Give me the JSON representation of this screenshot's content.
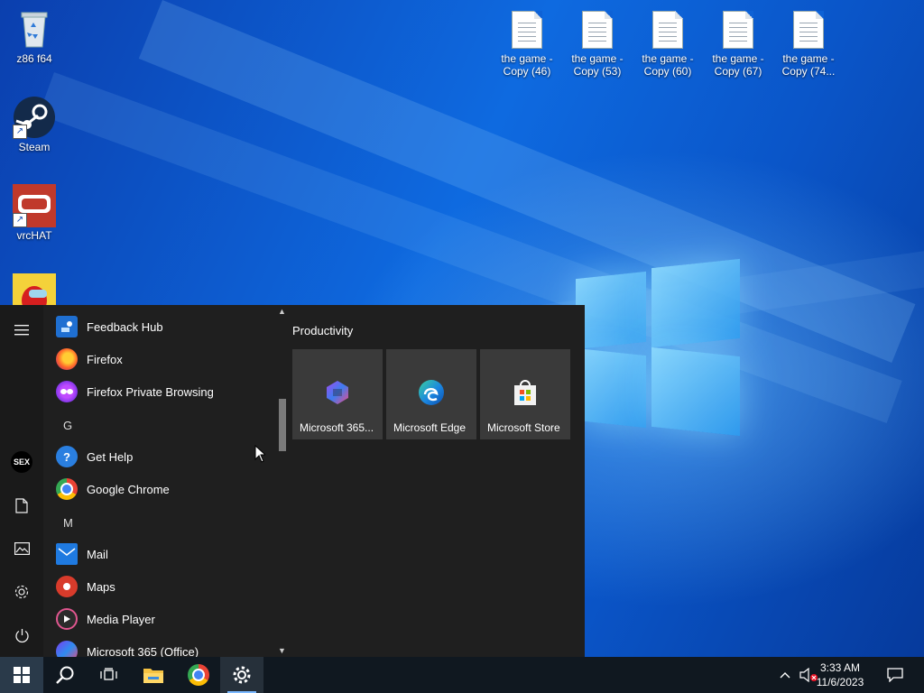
{
  "desktop": {
    "left_icons": [
      {
        "label": "z86 f64",
        "icon": "recycle-bin-icon"
      },
      {
        "label": "Steam",
        "icon": "steam-icon"
      },
      {
        "label": "vrcHAT",
        "icon": "vrchat-icon"
      },
      {
        "label": "",
        "icon": "among-us-icon"
      }
    ],
    "files": [
      {
        "line1": "the game -",
        "line2": "Copy (46)"
      },
      {
        "line1": "the game -",
        "line2": "Copy (53)"
      },
      {
        "line1": "the game -",
        "line2": "Copy (60)"
      },
      {
        "line1": "the game -",
        "line2": "Copy (67)"
      },
      {
        "line1": "the game -",
        "line2": "Copy (74..."
      }
    ]
  },
  "start_menu": {
    "rail": {
      "user_badge": "SEX"
    },
    "apps": [
      {
        "label": "Feedback Hub",
        "icon": "feedback-hub-icon"
      },
      {
        "label": "Firefox",
        "icon": "firefox-icon"
      },
      {
        "label": "Firefox Private Browsing",
        "icon": "firefox-private-icon"
      },
      {
        "label": "Get Help",
        "icon": "get-help-icon"
      },
      {
        "label": "Google Chrome",
        "icon": "chrome-icon"
      },
      {
        "label": "Mail",
        "icon": "mail-icon"
      },
      {
        "label": "Maps",
        "icon": "maps-icon"
      },
      {
        "label": "Media Player",
        "icon": "media-player-icon"
      },
      {
        "label": "Microsoft 365 (Office)",
        "icon": "office-icon"
      }
    ],
    "letters": [
      "G",
      "M"
    ],
    "tiles_group": "Productivity",
    "tiles": [
      {
        "label": "Microsoft 365...",
        "icon": "microsoft-365-icon"
      },
      {
        "label": "Microsoft Edge",
        "icon": "edge-icon"
      },
      {
        "label": "Microsoft Store",
        "icon": "store-icon"
      }
    ]
  },
  "taskbar": {
    "time": "3:33 AM",
    "date": "11/6/2023"
  },
  "colors": {
    "menu_bg": "#1f1f1f",
    "tile_bg": "#3a3a3a",
    "taskbar_bg": "#101820",
    "accent": "#0e6ae0"
  }
}
